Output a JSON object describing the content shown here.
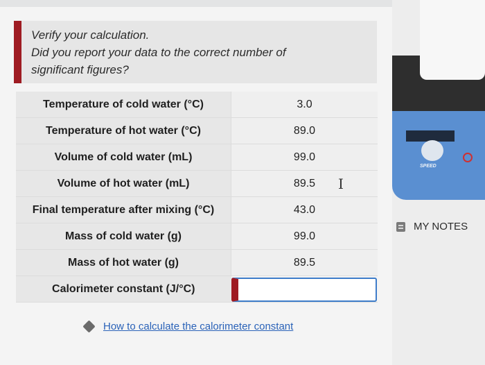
{
  "feedback": {
    "line1": "Verify your calculation.",
    "line2": "Did you report your data to the correct number of",
    "line3": "significant figures?"
  },
  "rows": [
    {
      "label": "Temperature of cold water (°C)",
      "value": "3.0"
    },
    {
      "label": "Temperature of hot water (°C)",
      "value": "89.0"
    },
    {
      "label": "Volume of cold water (mL)",
      "value": "99.0"
    },
    {
      "label": "Volume of hot water (mL)",
      "value": "89.5"
    },
    {
      "label": "Final temperature after mixing (°C)",
      "value": "43.0"
    },
    {
      "label": "Mass of cold water (g)",
      "value": "99.0"
    },
    {
      "label": "Mass of hot water (g)",
      "value": "89.5"
    }
  ],
  "calorimeter": {
    "label": "Calorimeter constant (J/°C)",
    "value": ""
  },
  "hint": {
    "link_text": "How to calculate the calorimeter constant",
    "icon": "tag-icon"
  },
  "notes": {
    "label": "MY NOTES",
    "icon": "notes-icon"
  },
  "photo": {
    "speed_label": "SPEED"
  },
  "colors": {
    "error_red": "#9e1b22",
    "input_border": "#3d7cc9",
    "link": "#2a62b8"
  }
}
